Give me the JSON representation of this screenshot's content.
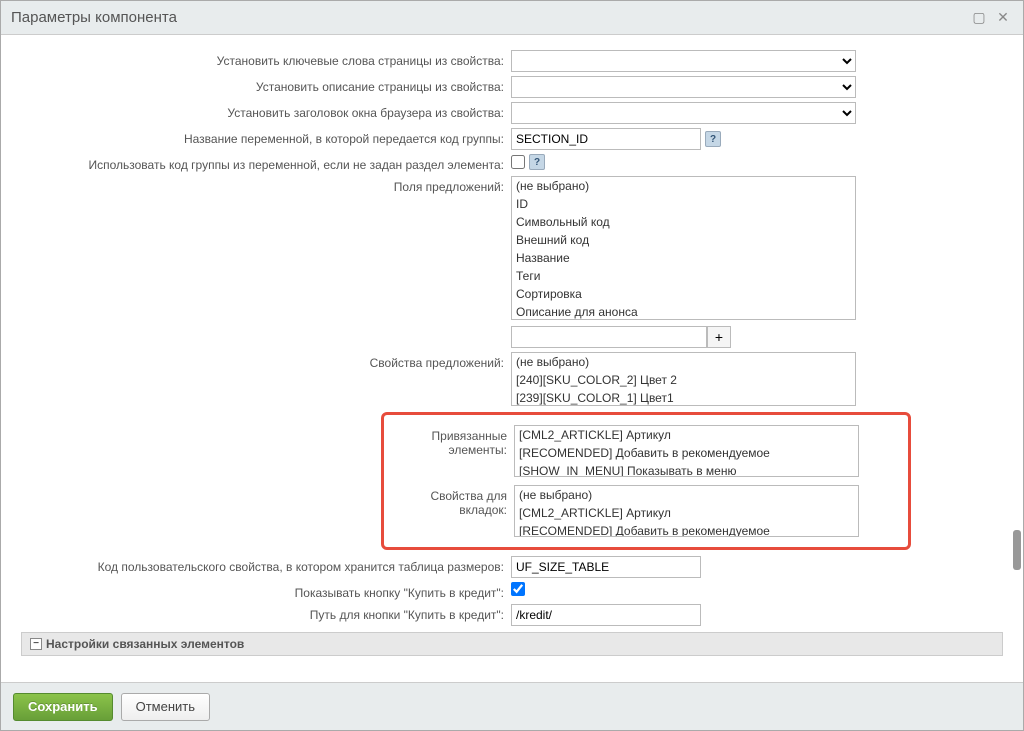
{
  "window": {
    "title": "Параметры компонента"
  },
  "labels": {
    "keywords": "Установить ключевые слова страницы из свойства:",
    "description": "Установить описание страницы из свойства:",
    "browser_title": "Установить заголовок окна браузера из свойства:",
    "var_name": "Название переменной, в которой передается код группы:",
    "use_var": "Использовать код группы из переменной, если не задан раздел элемента:",
    "offer_fields": "Поля предложений:",
    "offer_props": "Свойства предложений:",
    "linked_elements": "Привязанные элементы:",
    "tab_props": "Свойства для вкладок:",
    "size_table_code": "Код пользовательского свойства, в котором хранится таблица размеров:",
    "show_credit_btn": "Показывать кнопку \"Купить в кредит\":",
    "credit_path": "Путь для кнопки \"Купить в кредит\":"
  },
  "values": {
    "var_name": "SECTION_ID",
    "size_table_code": "UF_SIZE_TABLE",
    "credit_path": "/kredit/"
  },
  "offer_fields_options": [
    "(не выбрано)",
    "ID",
    "Символьный код",
    "Внешний код",
    "Название",
    "Теги",
    "Сортировка",
    "Описание для анонса"
  ],
  "offer_props_options": [
    "(не выбрано)",
    "[240][SKU_COLOR_2] Цвет 2",
    "[239][SKU_COLOR_1] Цвет1"
  ],
  "linked_elements_options": [
    "[CML2_ARTICKLE] Артикул",
    "[RECOMENDED] Добавить в рекомендуемое",
    "[SHOW_IN_MENU] Показывать в меню"
  ],
  "tab_props_options": [
    "(не выбрано)",
    "[CML2_ARTICKLE] Артикул",
    "[RECOMENDED] Добавить в рекомендуемое"
  ],
  "section_header": "Настройки связанных элементов",
  "footer": {
    "save": "Сохранить",
    "cancel": "Отменить"
  }
}
